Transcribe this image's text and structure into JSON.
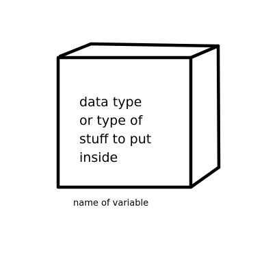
{
  "diagram": {
    "box_label_lines": [
      "data type",
      "or type of",
      "stuff to put",
      "inside"
    ],
    "caption": "name of variable",
    "stroke_color": "#000000",
    "background_color": "#ffffff"
  }
}
